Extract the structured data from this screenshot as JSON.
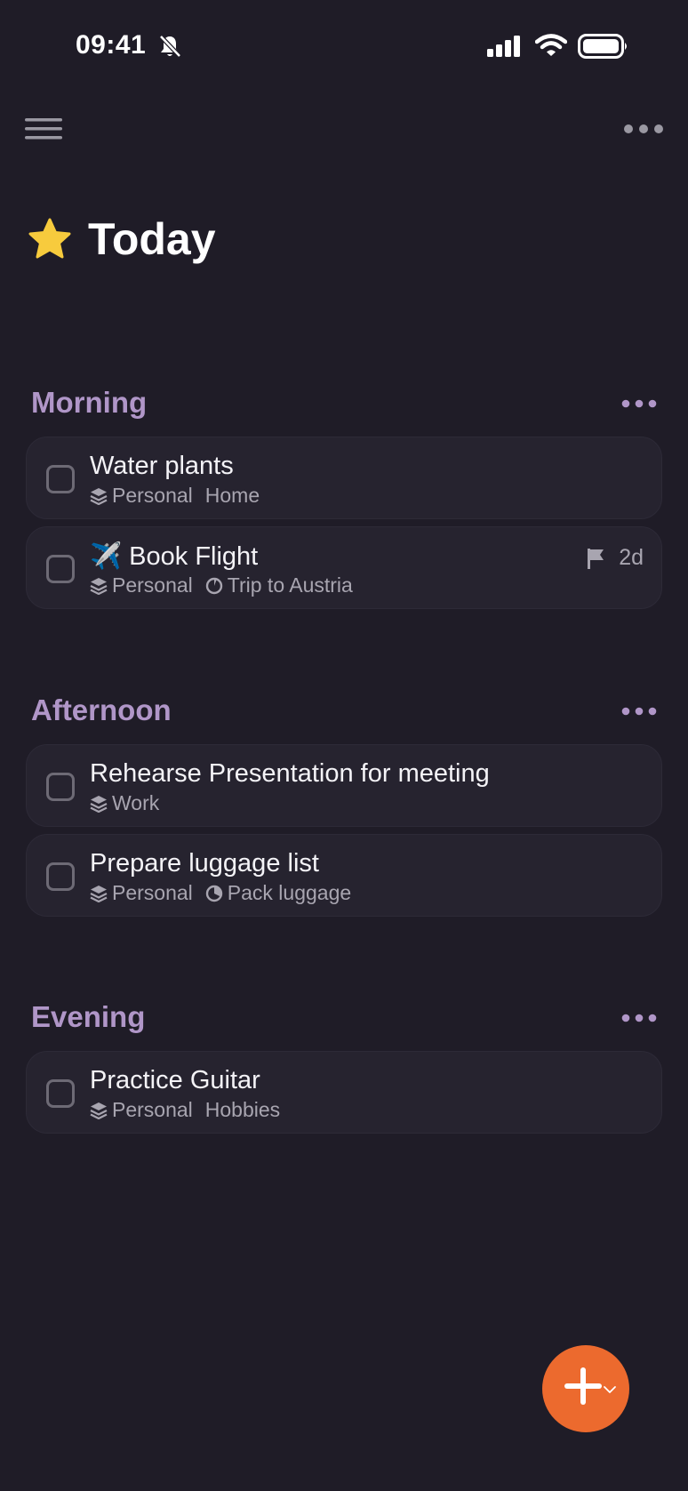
{
  "status_bar": {
    "time": "09:41"
  },
  "header": {
    "title": "Today"
  },
  "sections": [
    {
      "title": "Morning",
      "tasks": [
        {
          "title": "Water plants",
          "area": "Personal",
          "project": "Home"
        },
        {
          "title": "✈️ Book Flight",
          "area": "Personal",
          "project": "Trip to Austria",
          "deadline": "2d"
        }
      ]
    },
    {
      "title": "Afternoon",
      "tasks": [
        {
          "title": "Rehearse Presentation for meeting",
          "area": "Work"
        },
        {
          "title": "Prepare luggage list",
          "area": "Personal",
          "project": "Pack luggage"
        }
      ]
    },
    {
      "title": "Evening",
      "tasks": [
        {
          "title": "Practice Guitar",
          "area": "Personal",
          "project": "Hobbies"
        }
      ]
    }
  ],
  "colors": {
    "background": "#1f1c27",
    "card": "#26232f",
    "section_title": "#b096c8",
    "fab": "#ec6a2e"
  },
  "icons": [
    "menu-icon",
    "more-icon",
    "star-icon",
    "layers-icon",
    "clock-icon",
    "flag-icon",
    "plus-icon",
    "chevron-down-icon"
  ]
}
